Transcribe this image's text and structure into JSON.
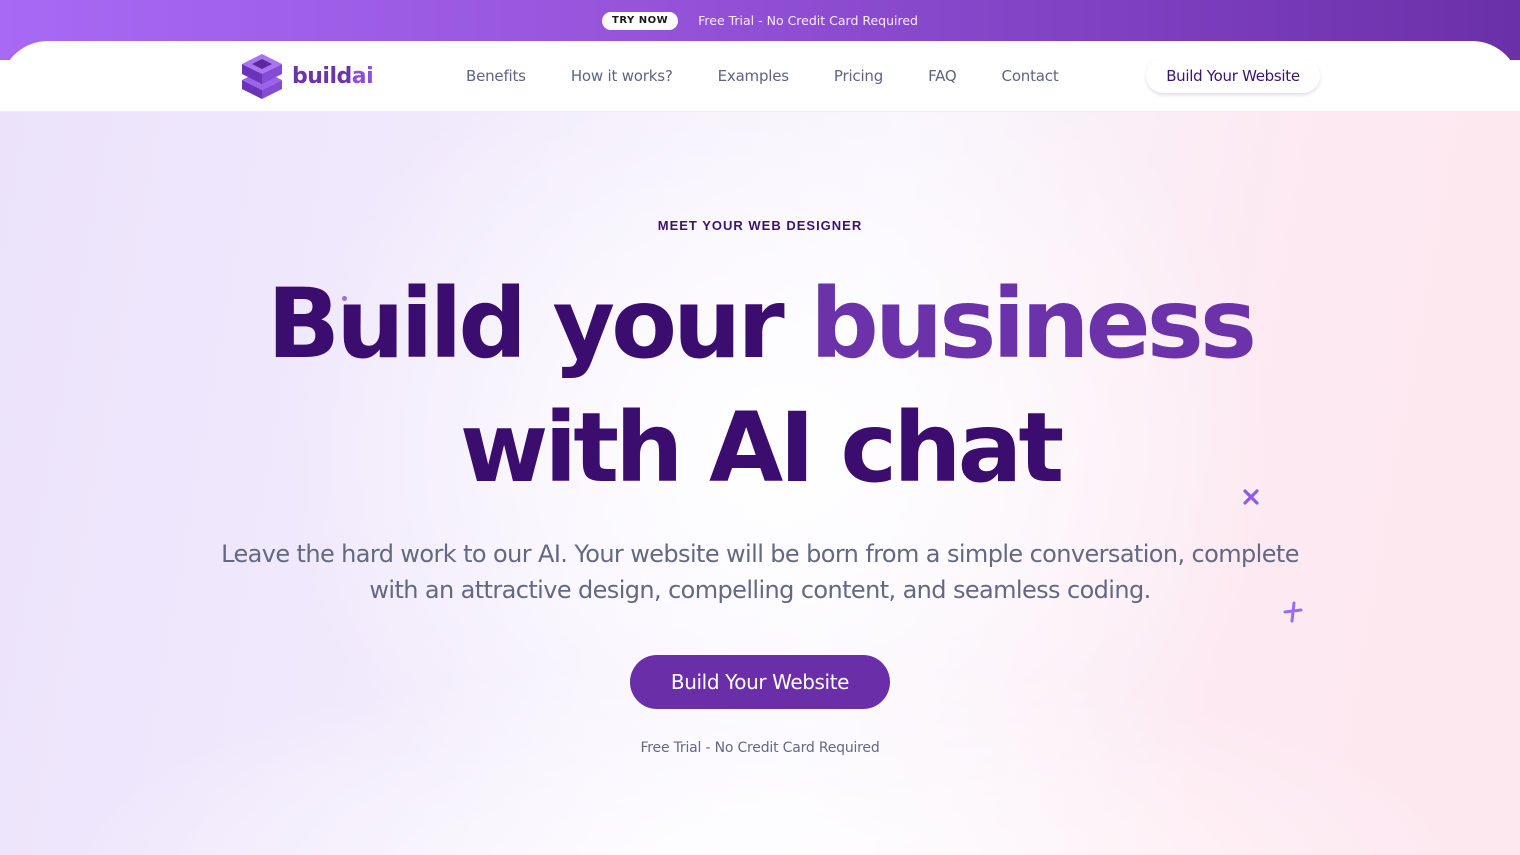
{
  "promo": {
    "badge_label": "TRY NOW",
    "text": "Free Trial - No Credit Card Required",
    "gradient_start": "#a869f4",
    "gradient_end": "#6a30a8"
  },
  "nav": {
    "logo": {
      "text_main": "build",
      "text_accent": "ai",
      "icon": "stacked-cube-icon"
    },
    "links": [
      {
        "label": "Benefits"
      },
      {
        "label": "How it works?"
      },
      {
        "label": "Examples"
      },
      {
        "label": "Pricing"
      },
      {
        "label": "FAQ"
      },
      {
        "label": "Contact"
      }
    ],
    "cta_label": "Build Your Website"
  },
  "hero": {
    "eyebrow": "MEET YOUR WEB DESIGNER",
    "headline_part1": "Build your ",
    "headline_accent": "business",
    "headline_part2": "with AI chat",
    "subtext": "Leave the hard work to our AI. Your website will be born from a simple conversation, complete with an attractive design, compelling content, and seamless coding.",
    "cta_label": "Build Your Website",
    "note": "Free Trial - No Credit Card Required",
    "decorations": [
      "sparkle-x-icon",
      "sparkle-plus-icon"
    ]
  },
  "colors": {
    "brand_dark": "#3b0d6e",
    "brand_accent": "#6b32aa",
    "cta_bg": "#6a2fa8",
    "body_text": "#636985",
    "sparkle": "#8a5cf0"
  }
}
